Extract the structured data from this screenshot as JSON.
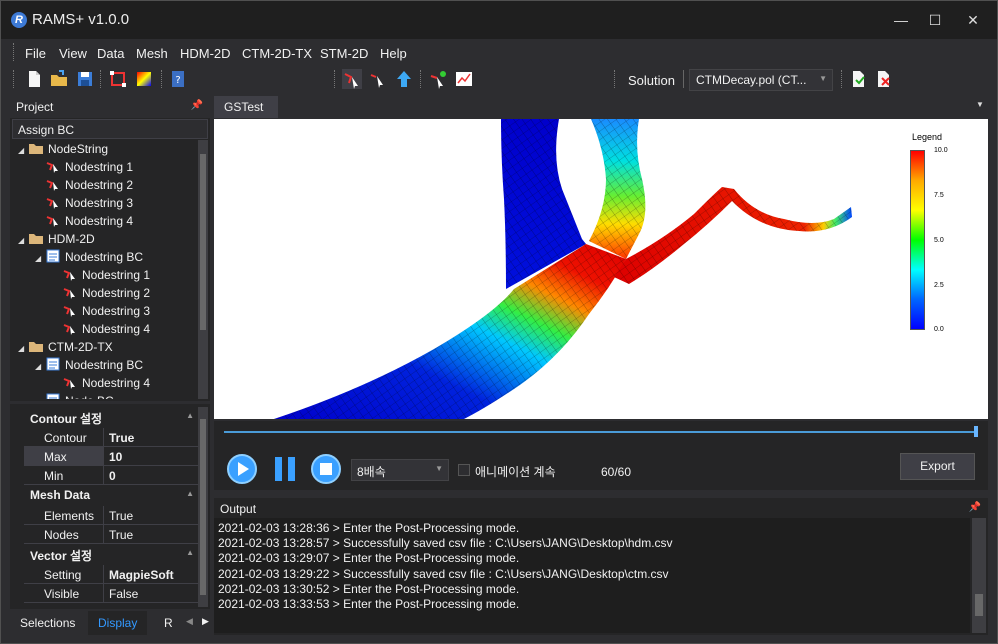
{
  "app": {
    "title": "RAMS+ v1.0.0",
    "logo_letter": "R"
  },
  "window_controls": {
    "minimize": "—",
    "maximize": "☐",
    "close": "✕"
  },
  "menu": [
    "File",
    "View",
    "Data",
    "Mesh",
    "HDM-2D",
    "CTM-2D-TX",
    "STM-2D",
    "Help"
  ],
  "toolbar": {
    "solution_label": "Solution",
    "solution_value": "CTMDecay.pol (CT..."
  },
  "project": {
    "title": "Project",
    "assign_bc": "Assign BC",
    "tree": [
      {
        "label": "NodeString",
        "level": 0,
        "kind": "folder"
      },
      {
        "label": "Nodestring 1",
        "level": 1,
        "kind": "node"
      },
      {
        "label": "Nodestring 2",
        "level": 1,
        "kind": "node"
      },
      {
        "label": "Nodestring 3",
        "level": 1,
        "kind": "node"
      },
      {
        "label": "Nodestring 4",
        "level": 1,
        "kind": "node"
      },
      {
        "label": "HDM-2D",
        "level": 0,
        "kind": "folder"
      },
      {
        "label": "Nodestring BC",
        "level": 1,
        "kind": "bc"
      },
      {
        "label": "Nodestring 1",
        "level": 2,
        "kind": "node"
      },
      {
        "label": "Nodestring 2",
        "level": 2,
        "kind": "node"
      },
      {
        "label": "Nodestring 3",
        "level": 2,
        "kind": "node"
      },
      {
        "label": "Nodestring 4",
        "level": 2,
        "kind": "node"
      },
      {
        "label": "CTM-2D-TX",
        "level": 0,
        "kind": "folder"
      },
      {
        "label": "Nodestring BC",
        "level": 1,
        "kind": "bc"
      },
      {
        "label": "Nodestring 4",
        "level": 2,
        "kind": "node"
      },
      {
        "label": "Node BC",
        "level": 1,
        "kind": "bc"
      }
    ]
  },
  "properties": {
    "contour_cat": "Contour 설정",
    "contour": {
      "key": "Contour",
      "value": "True"
    },
    "max": {
      "key": "Max",
      "value": "10"
    },
    "min": {
      "key": "Min",
      "value": "0"
    },
    "mesh_cat": "Mesh Data",
    "elements": {
      "key": "Elements",
      "value": "True"
    },
    "nodes": {
      "key": "Nodes",
      "value": "True"
    },
    "vector_cat": "Vector 설정",
    "setting": {
      "key": "Setting",
      "value": "MagpieSoft"
    },
    "visible": {
      "key": "Visible",
      "value": "False"
    }
  },
  "bottom_tabs": [
    "Selections",
    "Display",
    "R"
  ],
  "doc_tab": "GSTest",
  "legend": {
    "title": "Legend",
    "ticks": [
      "10.0",
      "7.5",
      "5.0",
      "2.5",
      "0.0"
    ]
  },
  "player": {
    "speed": "8배속",
    "animation_label": "애니메이션 계속",
    "frame": "60/60",
    "export_label": "Export",
    "progress": 1.0
  },
  "output": {
    "title": "Output",
    "lines": [
      "2021-02-03 13:28:36 > Enter the Post-Processing mode.",
      "2021-02-03 13:28:57 > Successfully saved csv file : C:\\Users\\JANG\\Desktop\\hdm.csv",
      "2021-02-03 13:29:07 > Enter the Post-Processing mode.",
      "2021-02-03 13:29:22 > Successfully saved csv file : C:\\Users\\JANG\\Desktop\\ctm.csv",
      "2021-02-03 13:30:52 > Enter the Post-Processing mode.",
      "2021-02-03 13:33:53 > Enter the Post-Processing mode."
    ]
  },
  "colors": {
    "accent": "#3399ff",
    "panel": "#252526",
    "background": "#2d2d30"
  }
}
